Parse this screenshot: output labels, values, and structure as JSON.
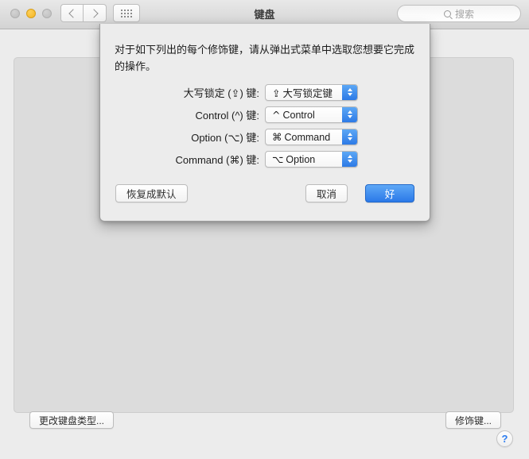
{
  "window": {
    "title": "键盘",
    "traffic_lights": [
      {
        "name": "close",
        "color": "#bdbdbd"
      },
      {
        "name": "minimize",
        "color": "#f5b522"
      },
      {
        "name": "zoom",
        "color": "#bdbdbd"
      }
    ]
  },
  "toolbar": {
    "back_icon": "chevron-left-icon",
    "forward_icon": "chevron-right-icon",
    "show_all_icon": "grid-icon",
    "search": {
      "placeholder": "搜索",
      "value": "",
      "icon": "search-icon"
    }
  },
  "main": {
    "change_keyboard_type_label": "更改键盘类型...",
    "modifier_keys_label": "修饰键...",
    "help_label": "?"
  },
  "sheet": {
    "description": "对于如下列出的每个修饰键，请从弹出式菜单中选取您想要它完成的操作。",
    "rows": [
      {
        "label": "大写锁定 (⇪) 键:",
        "symbol": "⇪",
        "value": "大写锁定键",
        "name": "caps-lock"
      },
      {
        "label": "Control (^) 键:",
        "symbol": "^",
        "value": "Control",
        "name": "control"
      },
      {
        "label": "Option (⌥) 键:",
        "symbol": "⌘",
        "value": "Command",
        "name": "option"
      },
      {
        "label": "Command (⌘) 键:",
        "symbol": "⌥",
        "value": "Option",
        "name": "command"
      }
    ],
    "buttons": {
      "restore_defaults": "恢复成默认",
      "cancel": "取消",
      "ok": "好"
    }
  },
  "colors": {
    "accent_blue": "#2b79e8",
    "stepper_blue": "#2d7ae6",
    "window_bg": "#ececec",
    "panel_bg": "#dcdcdc",
    "help_blue": "#2b7cf0"
  }
}
